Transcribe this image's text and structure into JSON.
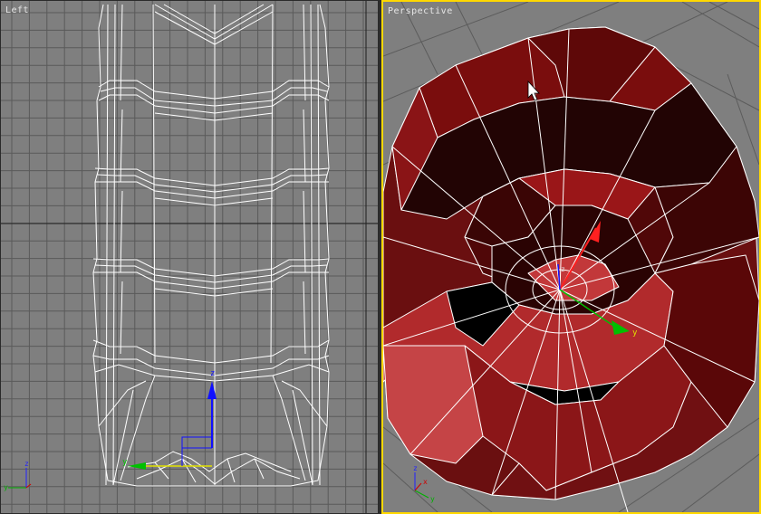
{
  "viewports": {
    "left": {
      "label": "Left"
    },
    "perspective": {
      "label": "Perspective"
    }
  },
  "gizmo": {
    "axis_z": "z",
    "axis_y": "y",
    "axis_x": "x"
  },
  "colors": {
    "viewport_bg": "#7f7f7f",
    "grid_line": "#5a5a5a",
    "active_border": "#ffd800",
    "wire": "#ffffff",
    "mesh_dark": "#5a0a0a",
    "mesh_mid": "#8e1414",
    "mesh_light": "#c0393b"
  }
}
